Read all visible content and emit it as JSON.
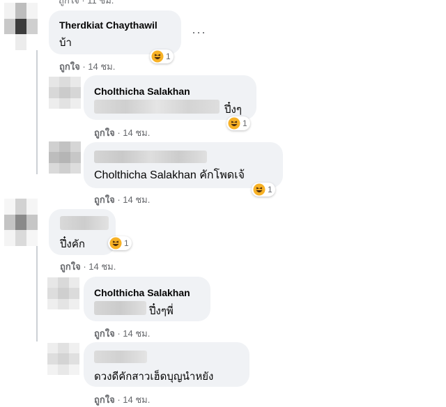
{
  "top_clip": "ถูกใจ · 11 ชม.",
  "more_label": "···",
  "comments": [
    {
      "name": "Therdkiat Chaythawil",
      "text": "บ้า",
      "reaction_count": "1",
      "like": "ถูกใจ",
      "time": "· 14 ชม."
    },
    {
      "name": "Cholthicha Salakhan",
      "text": "ปึ๋งๆ",
      "reaction_count": "1",
      "like": "ถูกใจ",
      "time": "· 14 ชม."
    },
    {
      "name": "",
      "text": "Cholthicha Salakhan คักโพดเจ้",
      "reaction_count": "1",
      "like": "ถูกใจ",
      "time": "· 14 ชม."
    },
    {
      "name": "",
      "text": "ปึ๋งคัก",
      "reaction_count": "1",
      "like": "ถูกใจ",
      "time": "· 14 ชม."
    },
    {
      "name": "Cholthicha Salakhan",
      "text": "ปึ๋งๆพี่",
      "like": "ถูกใจ",
      "time": "· 14 ชม."
    },
    {
      "name": "",
      "text": "ดวงดีคักสาวเฮ็ดบุญนำหยัง",
      "like": "ถูกใจ",
      "time": "· 14 ชม."
    }
  ],
  "colors": {
    "bubble": "#f0f2f5",
    "meta": "#65676b",
    "reaction": "#f7b125"
  },
  "icons": {
    "reaction": "haha-emoji-icon",
    "more": "more-options-icon"
  }
}
